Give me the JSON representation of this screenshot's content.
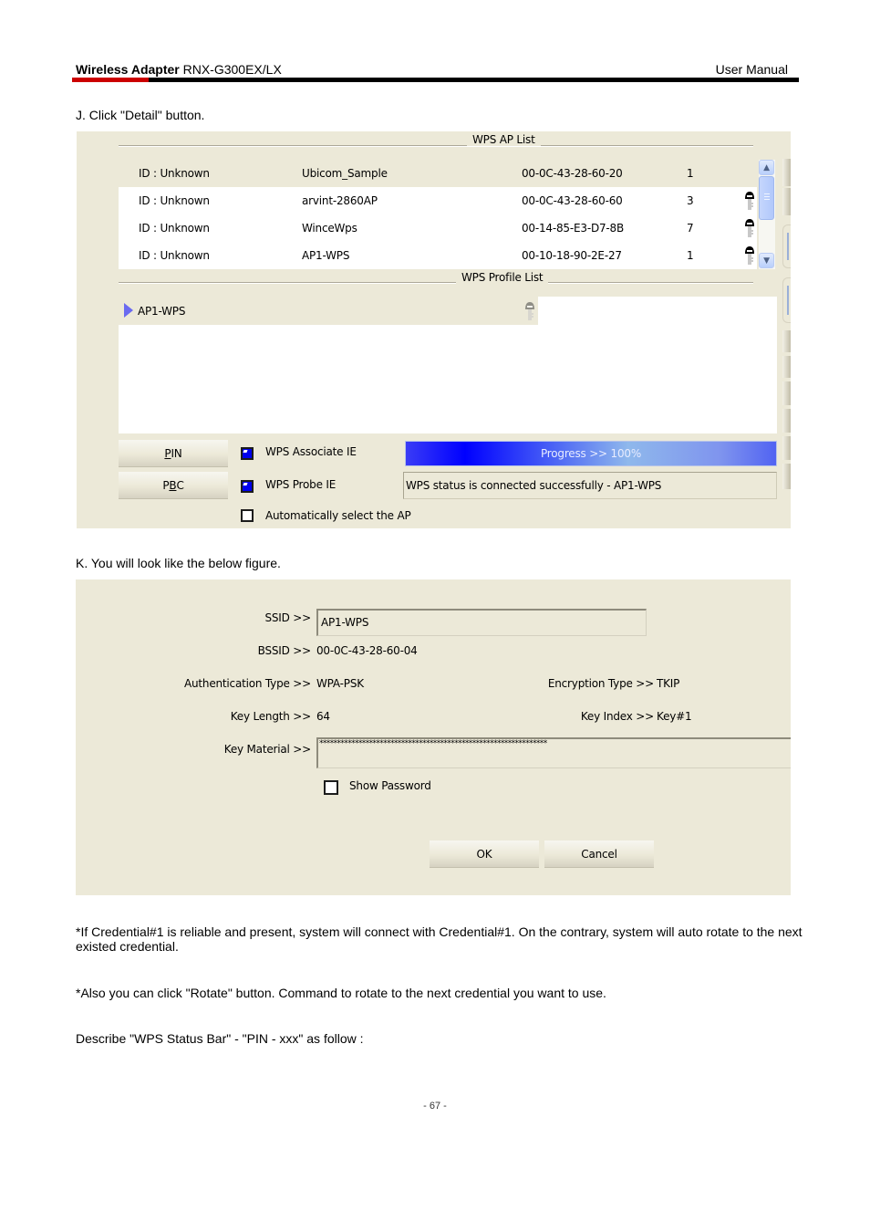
{
  "header": {
    "product_bold": "Wireless Adapter",
    "product_model": " RNX-G300EX/LX",
    "doc_type": "User Manual",
    "accent_color": "#cc0000"
  },
  "steps": {
    "j": "J. Click \"Detail\" button.",
    "k": "K. You will look like the below figure."
  },
  "wps_window": {
    "ap_list_title": "WPS AP List",
    "ap_list": [
      {
        "id": "ID : Unknown",
        "ssid": "Ubicom_Sample",
        "bssid": "00-0C-43-28-60-20",
        "channel": "1",
        "secured": false,
        "selected": true
      },
      {
        "id": "ID : Unknown",
        "ssid": "arvint-2860AP",
        "bssid": "00-0C-43-28-60-60",
        "channel": "3",
        "secured": true,
        "selected": false
      },
      {
        "id": "ID : Unknown",
        "ssid": "WinceWps",
        "bssid": "00-14-85-E3-D7-8B",
        "channel": "7",
        "secured": true,
        "selected": false
      },
      {
        "id": "ID : Unknown",
        "ssid": "AP1-WPS",
        "bssid": "00-10-18-90-2E-27",
        "channel": "1",
        "secured": true,
        "selected": false
      }
    ],
    "profile_list_title": "WPS Profile List",
    "profiles": [
      {
        "name": "AP1-WPS",
        "secured": true
      }
    ],
    "buttons": {
      "pin_label_accel": "P",
      "pin_label_rest": "IN",
      "pbc_label_pre": "P",
      "pbc_label_accel": "B",
      "pbc_label_rest": "C"
    },
    "options": [
      {
        "label": "WPS Associate IE",
        "checked": true
      },
      {
        "label": "WPS Probe IE",
        "checked": true
      },
      {
        "label": "Automatically select the AP",
        "checked": false
      }
    ],
    "progress": {
      "label": "Progress >> 100%",
      "percent": 100
    },
    "status_text": "WPS status is connected successfully - AP1-WPS"
  },
  "detail_dialog": {
    "ssid_label": "SSID >>",
    "ssid_value": "AP1-WPS",
    "bssid_label": "BSSID >>",
    "bssid_value": "00-0C-43-28-60-04",
    "auth_label": "Authentication Type >>",
    "auth_value": "WPA-PSK",
    "enc_label": "Encryption Type >>",
    "enc_value": "TKIP",
    "key_length_label": "Key Length >>",
    "key_length_value": "64",
    "key_index_label": "Key Index >>",
    "key_index_value": "Key#1",
    "key_material_label": "Key Material >>",
    "key_material_value": "****************************************************************",
    "show_password_label": "Show Password",
    "show_password_checked": false,
    "ok_label": "OK",
    "cancel_label": "Cancel"
  },
  "notes": {
    "credential_note": "*If Credential#1 is reliable and present, system will connect with Credential#1. On the contrary, system will auto rotate to the next existed credential.",
    "rotate_note": "*Also you can click \"Rotate\" button. Command to rotate to the next credential you want to use.",
    "describe_note": "Describe \"WPS Status Bar\" - \"PIN - xxx\" as follow :"
  },
  "footer": {
    "page_number": "- 67 -"
  }
}
